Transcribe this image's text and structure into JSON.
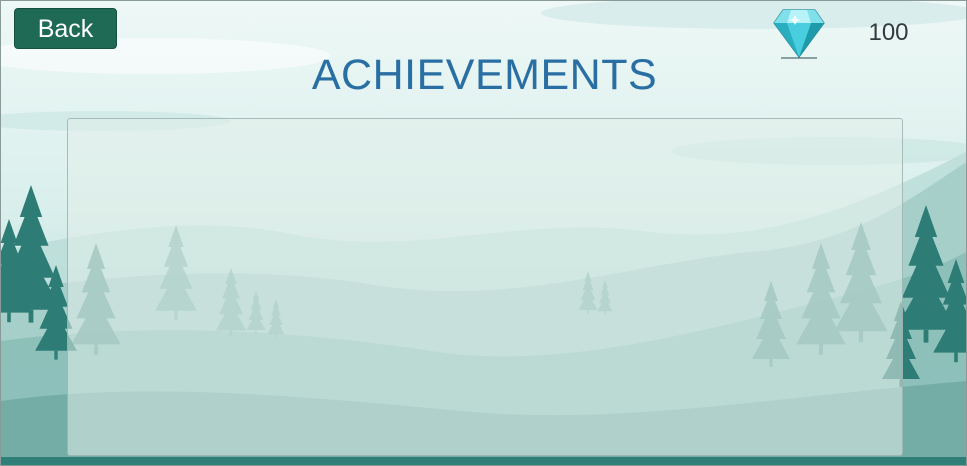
{
  "header": {
    "back_label": "Back",
    "title": "ACHIEVEMENTS"
  },
  "currency": {
    "icon": "diamond-icon",
    "value": "100",
    "color": "#3cc6d6"
  },
  "theme": {
    "accent": "#1f6a55",
    "title_color": "#2a6fa3"
  }
}
